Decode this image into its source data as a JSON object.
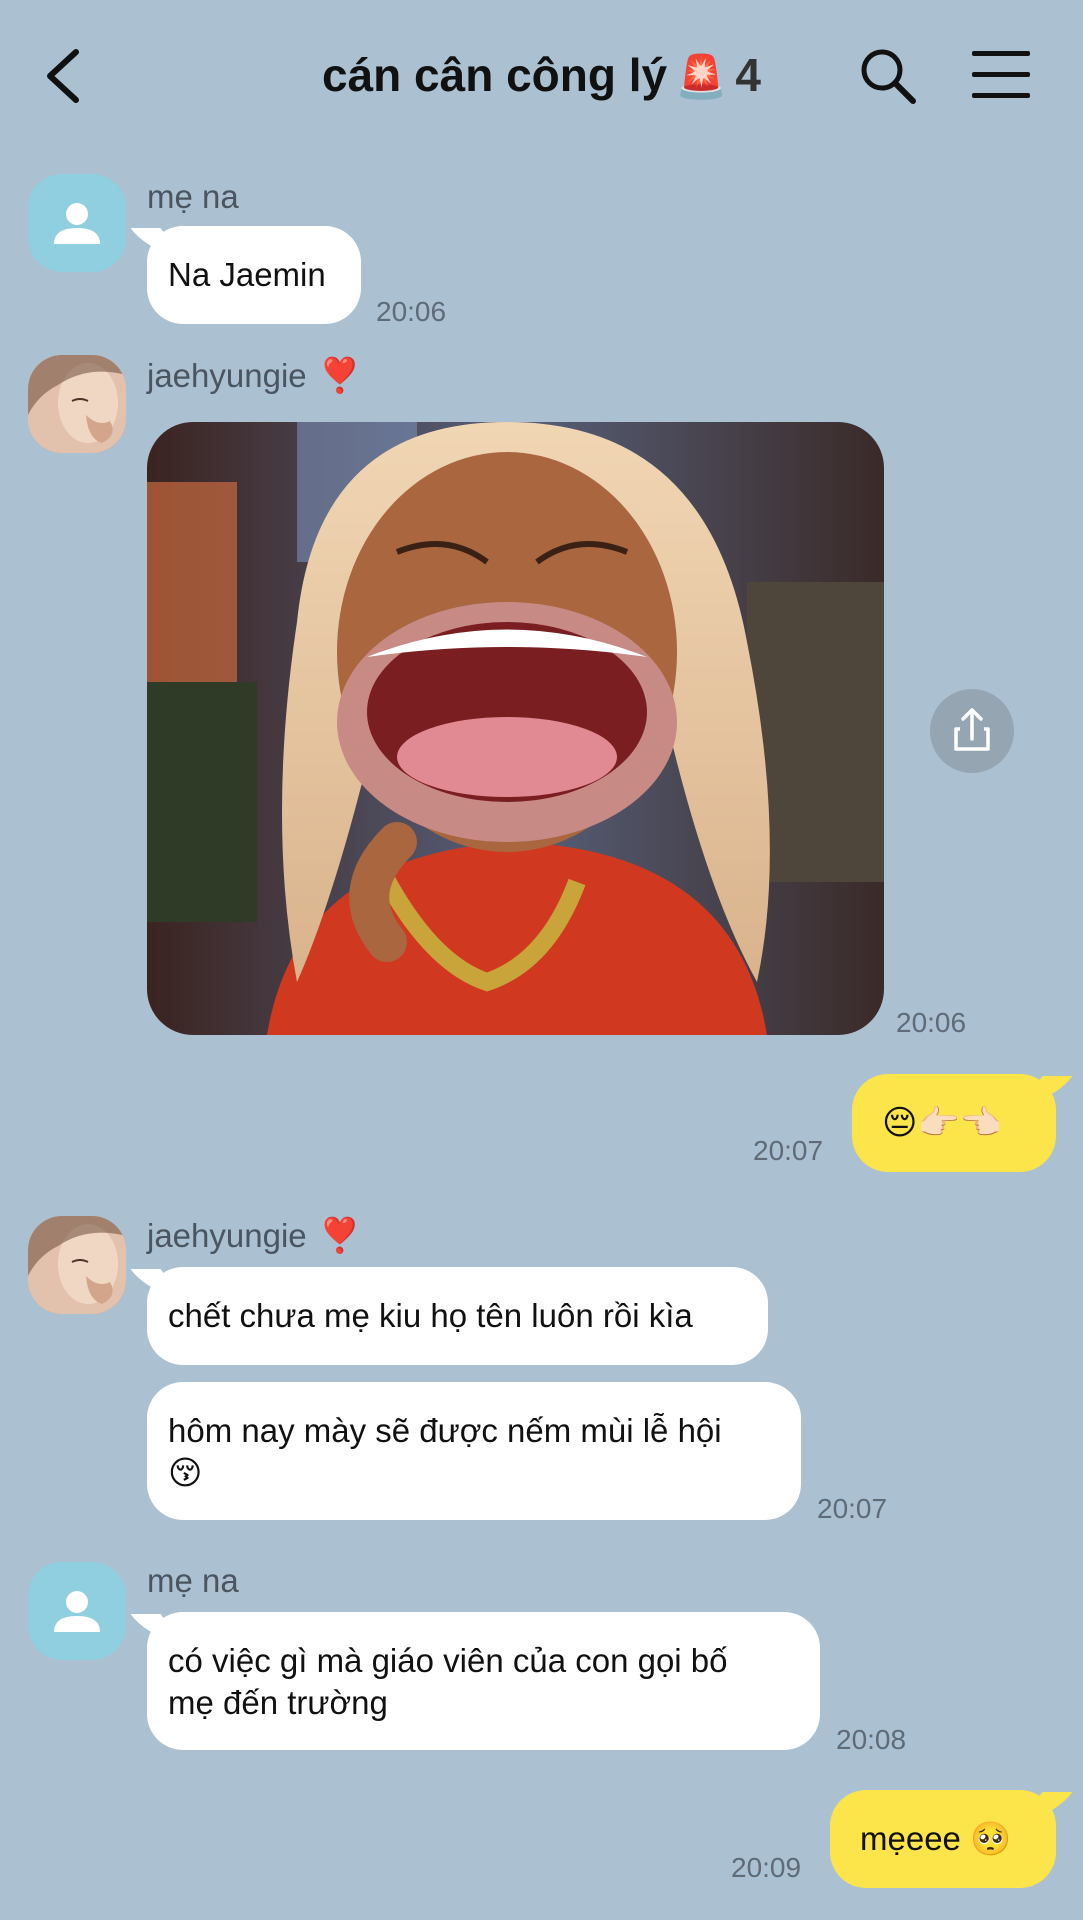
{
  "header": {
    "title": "cán cân công lý",
    "title_emoji": "🚨",
    "member_count": "4",
    "icons": [
      "back-chevron-icon",
      "search-icon",
      "menu-icon"
    ]
  },
  "messages": [
    {
      "sender": "mẹ na",
      "text": "Na Jaemin",
      "time": "20:06"
    },
    {
      "sender": "jaehyungie",
      "sender_emoji": "❣️",
      "image": "laughing meme photo",
      "time": "20:06"
    },
    {
      "from": "me",
      "text": "😔👉🏻👈🏻",
      "time": "20:07"
    },
    {
      "sender": "jaehyungie",
      "sender_emoji": "❣️",
      "texts": [
        "chết chưa mẹ kiu họ tên luôn rồi kìa",
        "hôm nay mày sẽ được nếm mùi lễ hội",
        "😚"
      ],
      "time": "20:07"
    },
    {
      "sender": "mẹ na",
      "texts": [
        "có việc gì mà giáo viên của con gọi bố",
        "mẹ đến trường"
      ],
      "time": "20:08"
    },
    {
      "from": "me",
      "text": "mẹeee 🥺",
      "time": "20:09"
    }
  ],
  "colors": {
    "background": "#abc1d1",
    "my_bubble": "#fbe54a",
    "their_bubble": "#ffffff",
    "default_avatar": "#8fcfe0",
    "heart": "#e3262e"
  }
}
